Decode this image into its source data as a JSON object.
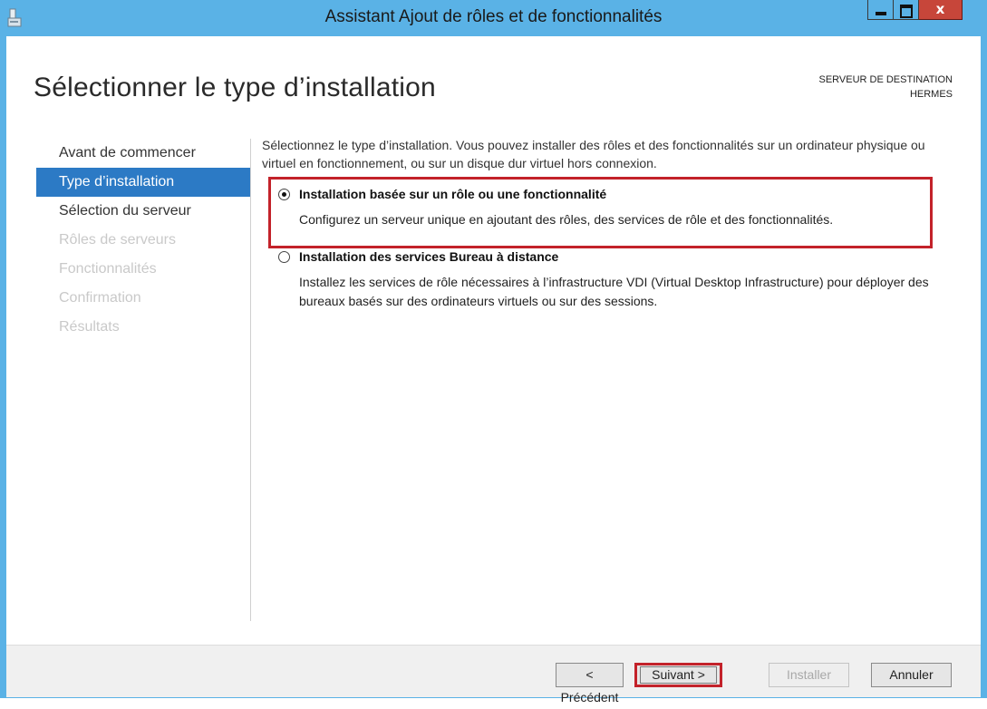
{
  "window": {
    "title": "Assistant Ajout de rôles et de fonctionnalités",
    "close_glyph": "x",
    "colors": {
      "frame": "#5ab2e6",
      "close": "#c7463a",
      "selection": "#2c7ac5",
      "highlight_box": "#c3222a"
    }
  },
  "header": {
    "page_title": "Sélectionner le type d’installation",
    "destination_label": "SERVEUR DE DESTINATION",
    "destination_server": "HERMES"
  },
  "nav": {
    "items": [
      {
        "label": "Avant de commencer",
        "state": "enabled"
      },
      {
        "label": "Type d’installation",
        "state": "selected"
      },
      {
        "label": "Sélection du serveur",
        "state": "enabled"
      },
      {
        "label": "Rôles de serveurs",
        "state": "disabled"
      },
      {
        "label": "Fonctionnalités",
        "state": "disabled"
      },
      {
        "label": "Confirmation",
        "state": "disabled"
      },
      {
        "label": "Résultats",
        "state": "disabled"
      }
    ]
  },
  "main": {
    "intro": "Sélectionnez le type d’installation. Vous pouvez installer des rôles et des fonctionnalités sur un ordinateur physique ou virtuel en fonctionnement, ou sur un disque dur virtuel hors connexion.",
    "options": [
      {
        "label": "Installation basée sur un rôle ou une fonctionnalité",
        "description": "Configurez un serveur unique en ajoutant des rôles, des services de rôle et des fonctionnalités.",
        "selected": true
      },
      {
        "label": "Installation des services Bureau à distance",
        "description": "Installez les services de rôle nécessaires à l’infrastructure VDI (Virtual Desktop Infrastructure) pour déployer des bureaux basés sur des ordinateurs virtuels ou sur des sessions.",
        "selected": false
      }
    ]
  },
  "footer": {
    "previous_label": "< Précédent",
    "next_label": "Suivant >",
    "install_label": "Installer",
    "cancel_label": "Annuler"
  }
}
